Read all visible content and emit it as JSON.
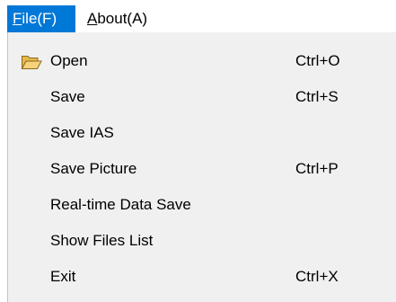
{
  "menubar": {
    "items": [
      {
        "mnemonic": "F",
        "rest": "ile(F)"
      },
      {
        "mnemonic": "A",
        "rest": "bout(A)"
      }
    ]
  },
  "file_menu": {
    "items": [
      {
        "label": "Open",
        "shortcut": "Ctrl+O",
        "icon": "folder-open-icon"
      },
      {
        "label": "Save",
        "shortcut": "Ctrl+S"
      },
      {
        "label": "Save IAS",
        "shortcut": ""
      },
      {
        "label": "Save Picture",
        "shortcut": "Ctrl+P"
      },
      {
        "label": "Real-time Data Save",
        "shortcut": ""
      },
      {
        "label": "Show Files List",
        "shortcut": ""
      },
      {
        "label": "Exit",
        "shortcut": "Ctrl+X"
      }
    ]
  },
  "colors": {
    "highlight": "#0078d7",
    "menu_background": "#f0f0f0",
    "folder_icon": "#e8b84a"
  }
}
